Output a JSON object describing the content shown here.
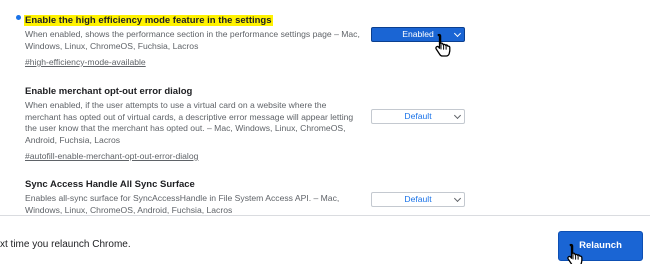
{
  "flags": [
    {
      "title": "Enable the high efficiency mode feature in the settings",
      "description": "When enabled, shows the performance section in the performance settings page – Mac, Windows, Linux, ChromeOS, Fuchsia, Lacros",
      "link": "#high-efficiency-mode-available",
      "value": "Enabled"
    },
    {
      "title": "Enable merchant opt-out error dialog",
      "description": "When enabled, if the user attempts to use a virtual card on a website where the merchant has opted out of virtual cards, a descriptive error message will appear letting the user know that the merchant has opted out. – Mac, Windows, Linux, ChromeOS, Android, Fuchsia, Lacros",
      "link": "#autofill-enable-merchant-opt-out-error-dialog",
      "value": "Default"
    },
    {
      "title": "Sync Access Handle All Sync Surface",
      "description": "Enables all-sync surface for SyncAccessHandle in File System Access API. – Mac, Windows, Linux, ChromeOS, Android, Fuchsia, Lacros",
      "value": "Default"
    }
  ],
  "footer": {
    "message": "xt time you relaunch Chrome.",
    "relaunch_label": "Relaunch"
  },
  "colors": {
    "accent": "#1a65d4",
    "highlight": "#fff200",
    "link_text": "#5f6368"
  },
  "icons": [
    "bullet-dot-icon",
    "chevron-down-icon",
    "hand-pointer-cursor-icon"
  ]
}
